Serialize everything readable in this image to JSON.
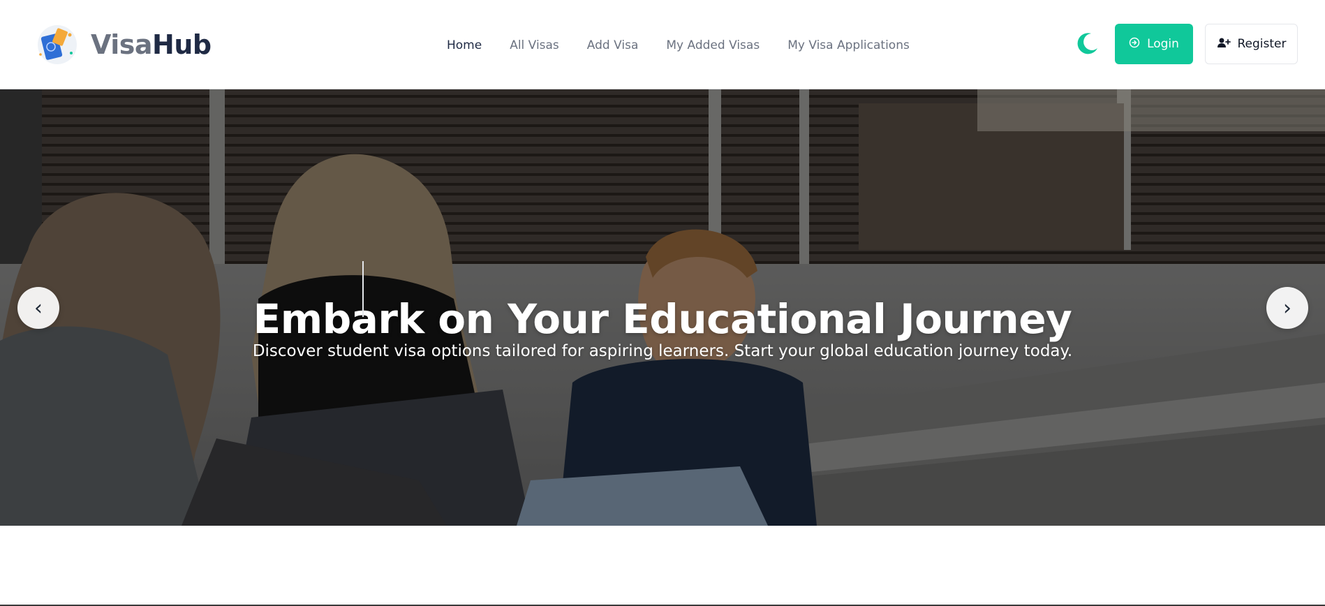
{
  "brand": {
    "name_part1": "Visa",
    "name_part2": "Hub",
    "logo_icon": "passport-icon"
  },
  "nav": {
    "links": [
      {
        "label": "Home",
        "active": true
      },
      {
        "label": "All Visas",
        "active": false
      },
      {
        "label": "Add Visa",
        "active": false
      },
      {
        "label": "My Added Visas",
        "active": false
      },
      {
        "label": "My Visa Applications",
        "active": false
      }
    ],
    "theme_toggle_icon": "moon-icon",
    "login_label": "Login",
    "login_icon": "login-icon",
    "register_label": "Register",
    "register_icon": "user-plus-icon"
  },
  "hero": {
    "title": "Embark on Your Educational Journey",
    "subtitle": "Discover student visa options tailored for aspiring learners. Start your global education journey today.",
    "prev_label": "‹",
    "next_label": "›"
  },
  "colors": {
    "accent": "#10c89a",
    "brand_dark": "#1f2a44",
    "muted": "#6b7280"
  }
}
